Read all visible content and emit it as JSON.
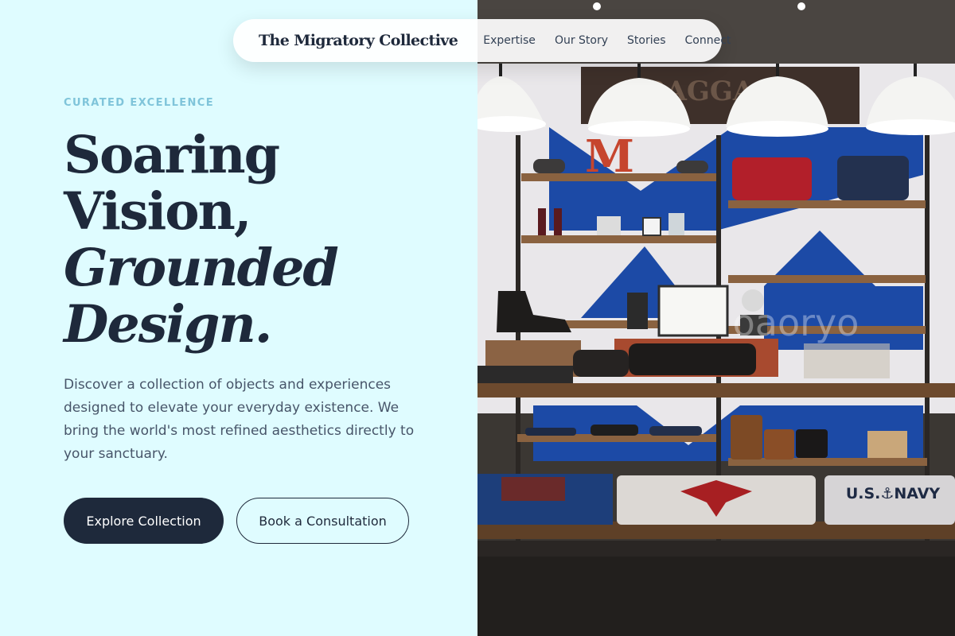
{
  "nav": {
    "brand": "The Migratory Collective",
    "links": [
      {
        "label": "Expertise"
      },
      {
        "label": "Our Story"
      },
      {
        "label": "Stories"
      },
      {
        "label": "Connect"
      }
    ]
  },
  "hero": {
    "eyebrow": "CURATED EXCELLENCE",
    "headline_lines": [
      "Soaring",
      "Vision,",
      "Grounded",
      "Design."
    ],
    "lede": "Discover a collection of objects and experiences designed to elevate your everyday existence. We bring the world's most refined aesthetics directly to your sanctuary.",
    "primary_cta": "Explore Collection",
    "secondary_cta": "Book a Consultation"
  },
  "image": {
    "baggage_sign": "BAGGAGE",
    "letter_m": "M",
    "navy_text": "U.S.⚓NAVY",
    "watermark": "oaoryo"
  },
  "colors": {
    "background": "#dffcff",
    "ink": "#1e293b",
    "eyebrow": "#7fc4da",
    "body_text": "#475569"
  }
}
